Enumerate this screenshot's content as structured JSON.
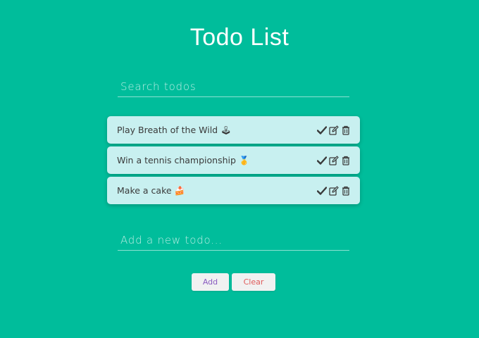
{
  "header": {
    "title": "Todo List"
  },
  "search": {
    "placeholder": "Search todos",
    "value": ""
  },
  "todos": [
    {
      "text": "Play Breath of the Wild",
      "emoji": "🕹",
      "emoji_name": "joystick-icon"
    },
    {
      "text": "Win a tennis championship",
      "emoji": "🥇",
      "emoji_name": "medal-icon"
    },
    {
      "text": "Make a cake",
      "emoji": "🍰",
      "emoji_name": "cake-icon"
    }
  ],
  "actions": {
    "complete": "check-icon",
    "edit": "edit-icon",
    "delete": "trash-icon"
  },
  "new_todo": {
    "placeholder": "Add a new todo...",
    "value": ""
  },
  "buttons": {
    "add_label": "Add",
    "clear_label": "Clear"
  },
  "colors": {
    "background": "#00bd9b",
    "todo_bg": "#c8f0f0",
    "add_text": "#8a5bc0",
    "clear_text": "#e05a5a",
    "icon": "#3a3a3a"
  }
}
